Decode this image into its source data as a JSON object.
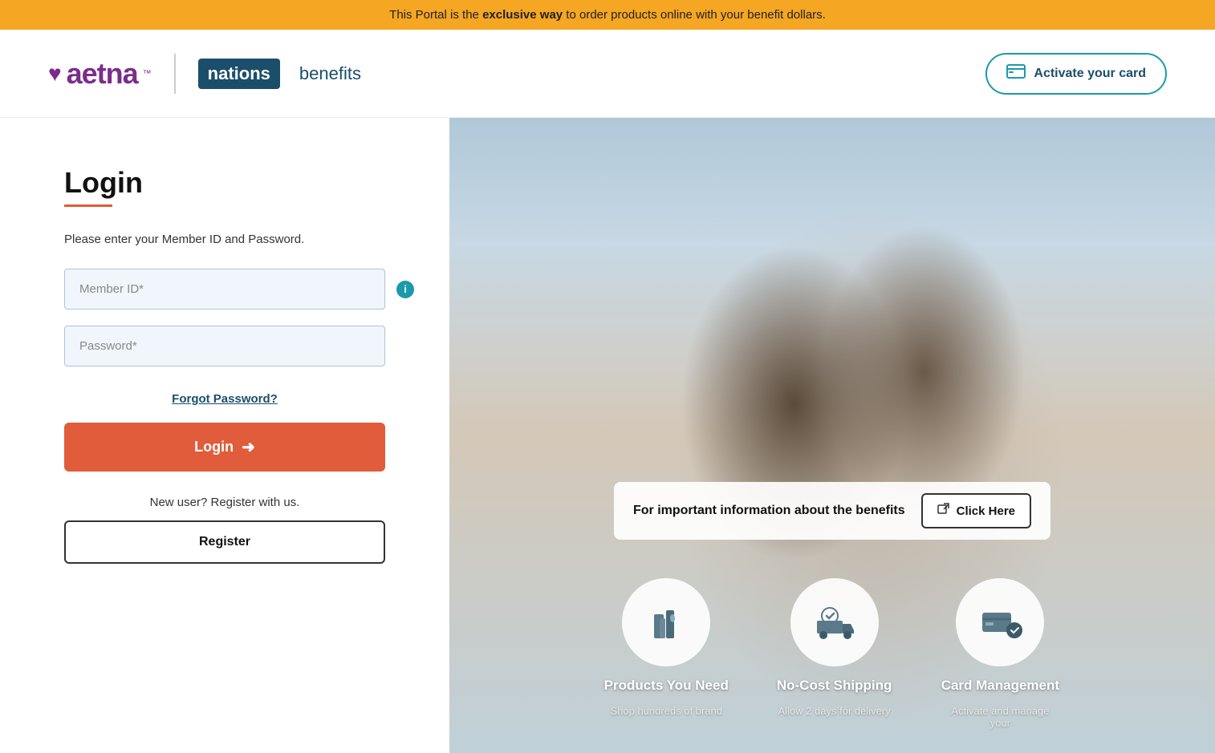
{
  "banner": {
    "text_before": "This Portal is the ",
    "text_bold": "exclusive way",
    "text_after": " to order products online with your benefit dollars."
  },
  "header": {
    "aetna_label": "aetna",
    "aetna_tm": "™",
    "nations_label": "nations",
    "benefits_label": "benefits",
    "activate_card_label": "Activate your card"
  },
  "login": {
    "title": "Login",
    "subtitle": "Please enter your Member ID and Password.",
    "member_id_placeholder": "Member ID*",
    "password_placeholder": "Password*",
    "forgot_password_label": "Forgot Password?",
    "login_button_label": "Login",
    "new_user_text": "New user? Register with us.",
    "register_button_label": "Register"
  },
  "image_panel": {
    "info_bar_text": "For important information about the benefits",
    "click_here_label": "Click Here",
    "features": [
      {
        "icon": "🧴",
        "title": "Products You Need",
        "desc": "Shop hundreds of brand"
      },
      {
        "icon": "🚚",
        "title": "No-Cost Shipping",
        "desc": "Allow 2 days for delivery"
      },
      {
        "icon": "💳",
        "title": "Card Management",
        "desc": "Activate and manage your"
      }
    ]
  }
}
